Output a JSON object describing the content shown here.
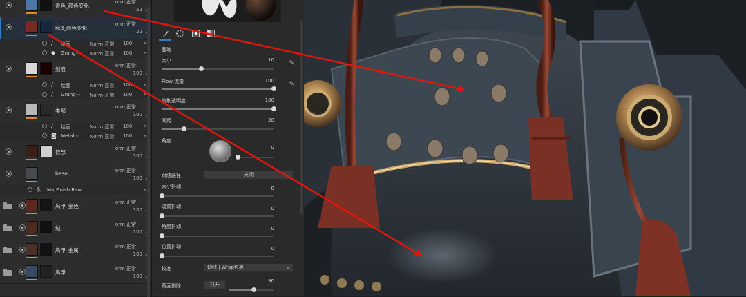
{
  "layers": [
    {
      "name": "青色_颜色变化",
      "blend": "orm 正常",
      "opacity": "52",
      "type": "layer",
      "thumb": "#4a78a8",
      "mask": "#111111",
      "selected": false
    },
    {
      "name": "red_颜色变化",
      "blend": "orm 正常",
      "opacity": "22",
      "type": "layer",
      "thumb": "#7a2a22",
      "mask": "#16283a",
      "selected": true,
      "subs": [
        {
          "icon": "brush-icon",
          "name": "绘画",
          "blend": "Norm 正常",
          "opacity": "100"
        },
        {
          "icon": "fill-icon",
          "name": "Grung⋯",
          "blend": "Norm 正常",
          "opacity": "100"
        }
      ]
    },
    {
      "name": "划痕",
      "blend": "orm 正常",
      "opacity": "100",
      "type": "layer",
      "thumb": "#d8d8d8",
      "mask": "#1a0000",
      "selected": false,
      "subs": [
        {
          "icon": "brush-icon",
          "name": "绘画",
          "blend": "Norm 正常",
          "opacity": "100"
        },
        {
          "icon": "brush-icon",
          "name": "Grung⋯",
          "blend": "Norm 正常",
          "opacity": "100"
        }
      ]
    },
    {
      "name": "类部",
      "blend": "orm 正常",
      "opacity": "100",
      "type": "layer",
      "thumb": "#b9b9b9",
      "mask": "#2a2a2a",
      "selected": false,
      "subs": [
        {
          "icon": "brush-icon",
          "name": "绘画",
          "blend": "Norm 正常",
          "opacity": "100"
        },
        {
          "icon": "generator-icon",
          "name": "Metal⋯",
          "blend": "Norm 正常",
          "opacity": "100"
        }
      ]
    },
    {
      "name": "锦部",
      "blend": "orm 正常",
      "opacity": "100",
      "type": "layer",
      "thumb": "#3a1e1a",
      "mask": "#d0d0d0",
      "selected": false
    },
    {
      "name": "base",
      "blend": "orm 正常",
      "opacity": "100",
      "type": "layer",
      "thumb": "#474a52",
      "mask": "",
      "selected": false,
      "subs": [
        {
          "icon": "material-icon",
          "name": "MatFinish Raw",
          "blend": "",
          "opacity": ""
        }
      ]
    },
    {
      "name": "肩甲_金色",
      "blend": "orm 正常",
      "opacity": "100",
      "type": "folder",
      "thumb": "#5a2a20",
      "mask": "#151515",
      "selected": false
    },
    {
      "name": "绒",
      "blend": "orm 正常",
      "opacity": "100",
      "type": "folder",
      "thumb": "#4b2a22",
      "mask": "#111111",
      "selected": false
    },
    {
      "name": "肩甲_金属",
      "blend": "orm 正常",
      "opacity": "100",
      "type": "folder",
      "thumb": "#4a3026",
      "mask": "#121212",
      "selected": false
    },
    {
      "name": "肩甲",
      "blend": "orm 正常",
      "opacity": "100",
      "type": "folder",
      "thumb": "#3a4a62",
      "mask": "#222222",
      "selected": false
    }
  ],
  "props": {
    "section": "画笔",
    "size": {
      "label": "大小",
      "value": "10",
      "fraction": 0.35
    },
    "flow": {
      "label": "Flow 流量",
      "value": "100",
      "fraction": 1
    },
    "opacity": {
      "label": "笔刷透明度",
      "value": "100",
      "fraction": 1
    },
    "spacing": {
      "label": "间距",
      "value": "20",
      "fraction": 0.2
    },
    "angle": {
      "label": "角度",
      "value": "0",
      "fraction": 0
    },
    "follow": {
      "label": "跟随路径",
      "value": "关闭"
    },
    "size_jitter": {
      "label": "大小抖动",
      "value": "0"
    },
    "flow_jitter": {
      "label": "流量抖动",
      "value": "0"
    },
    "angle_jitter": {
      "label": "角度抖动",
      "value": "0"
    },
    "pos_jitter": {
      "label": "位置抖动",
      "value": "0"
    },
    "alignment": {
      "label": "校准",
      "value": "切线 | Wrap包裹"
    },
    "backface": {
      "label": "背面剔除",
      "value": "打开",
      "number": "90",
      "fraction": 0.55
    }
  },
  "colors": {
    "accent": "#3b78c4",
    "orange": "#e58a1e",
    "arrow": "#e0160e"
  }
}
